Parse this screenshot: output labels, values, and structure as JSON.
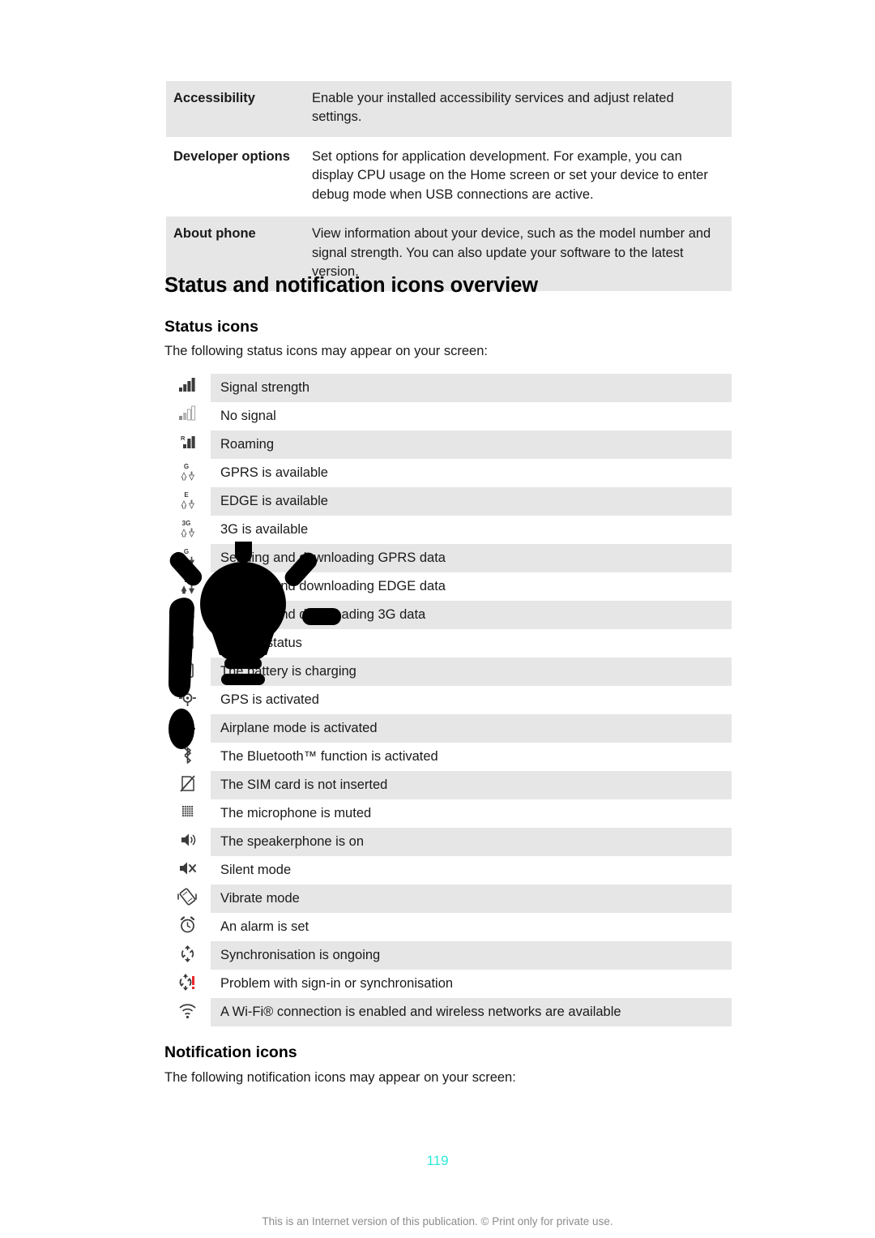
{
  "settings_table": {
    "rows": [
      {
        "label": "Accessibility",
        "description": "Enable your installed accessibility services and adjust related settings."
      },
      {
        "label": "Developer options",
        "description": "Set options for application development. For example, you can display CPU usage on the Home screen or set your device to enter debug mode when USB connections are active."
      },
      {
        "label": "About phone",
        "description": "View information about your device, such as the model number and signal strength. You can also update your software to the latest version."
      }
    ]
  },
  "section_title": "Status and notification icons overview",
  "status_section": {
    "heading": "Status icons",
    "intro": "The following status icons may appear on your screen:",
    "rows": [
      {
        "icon": "signal-strength-icon",
        "text": "Signal strength"
      },
      {
        "icon": "no-signal-icon",
        "text": "No signal"
      },
      {
        "icon": "roaming-icon",
        "text": "Roaming"
      },
      {
        "icon": "gprs-available-icon",
        "text": "GPRS is available"
      },
      {
        "icon": "edge-available-icon",
        "text": "EDGE is available"
      },
      {
        "icon": "3g-available-icon",
        "text": "3G is available"
      },
      {
        "icon": "gprs-data-transfer-icon",
        "text": "Sending and downloading GPRS data"
      },
      {
        "icon": "edge-data-transfer-icon",
        "text": "Sending and downloading EDGE data"
      },
      {
        "icon": "3g-data-transfer-icon",
        "text": "Sending and downloading 3G data"
      },
      {
        "icon": "battery-status-icon",
        "text": "Battery status"
      },
      {
        "icon": "battery-charging-icon",
        "text": "The battery is charging"
      },
      {
        "icon": "gps-icon",
        "text": "GPS is activated"
      },
      {
        "icon": "airplane-mode-icon",
        "text": "Airplane mode is activated"
      },
      {
        "icon": "bluetooth-icon",
        "text": "The Bluetooth™ function is activated"
      },
      {
        "icon": "no-sim-card-icon",
        "text": "The SIM card is not inserted"
      },
      {
        "icon": "microphone-muted-icon",
        "text": "The microphone is muted"
      },
      {
        "icon": "speakerphone-icon",
        "text": "The speakerphone is on"
      },
      {
        "icon": "silent-mode-icon",
        "text": "Silent mode"
      },
      {
        "icon": "vibrate-mode-icon",
        "text": "Vibrate mode"
      },
      {
        "icon": "alarm-icon",
        "text": "An alarm is set"
      },
      {
        "icon": "sync-ongoing-icon",
        "text": "Synchronisation is ongoing"
      },
      {
        "icon": "sync-problem-icon",
        "text": "Problem with sign-in or synchronisation"
      },
      {
        "icon": "wifi-icon",
        "text": "A Wi-Fi® connection is enabled and wireless networks are available"
      }
    ]
  },
  "notification_section": {
    "heading": "Notification icons",
    "intro": "The following notification icons may appear on your screen:"
  },
  "page_number": "119",
  "footer_note": "This is an Internet version of this publication. © Print only for private use.",
  "colors": {
    "row_shaded": "#e6e6e6",
    "row_plain": "#ffffff",
    "page_number": "#2fe9d9",
    "footer_text": "#8c8c8c",
    "alert_red": "#e8262a",
    "icon_dark": "#3b3b3b"
  }
}
